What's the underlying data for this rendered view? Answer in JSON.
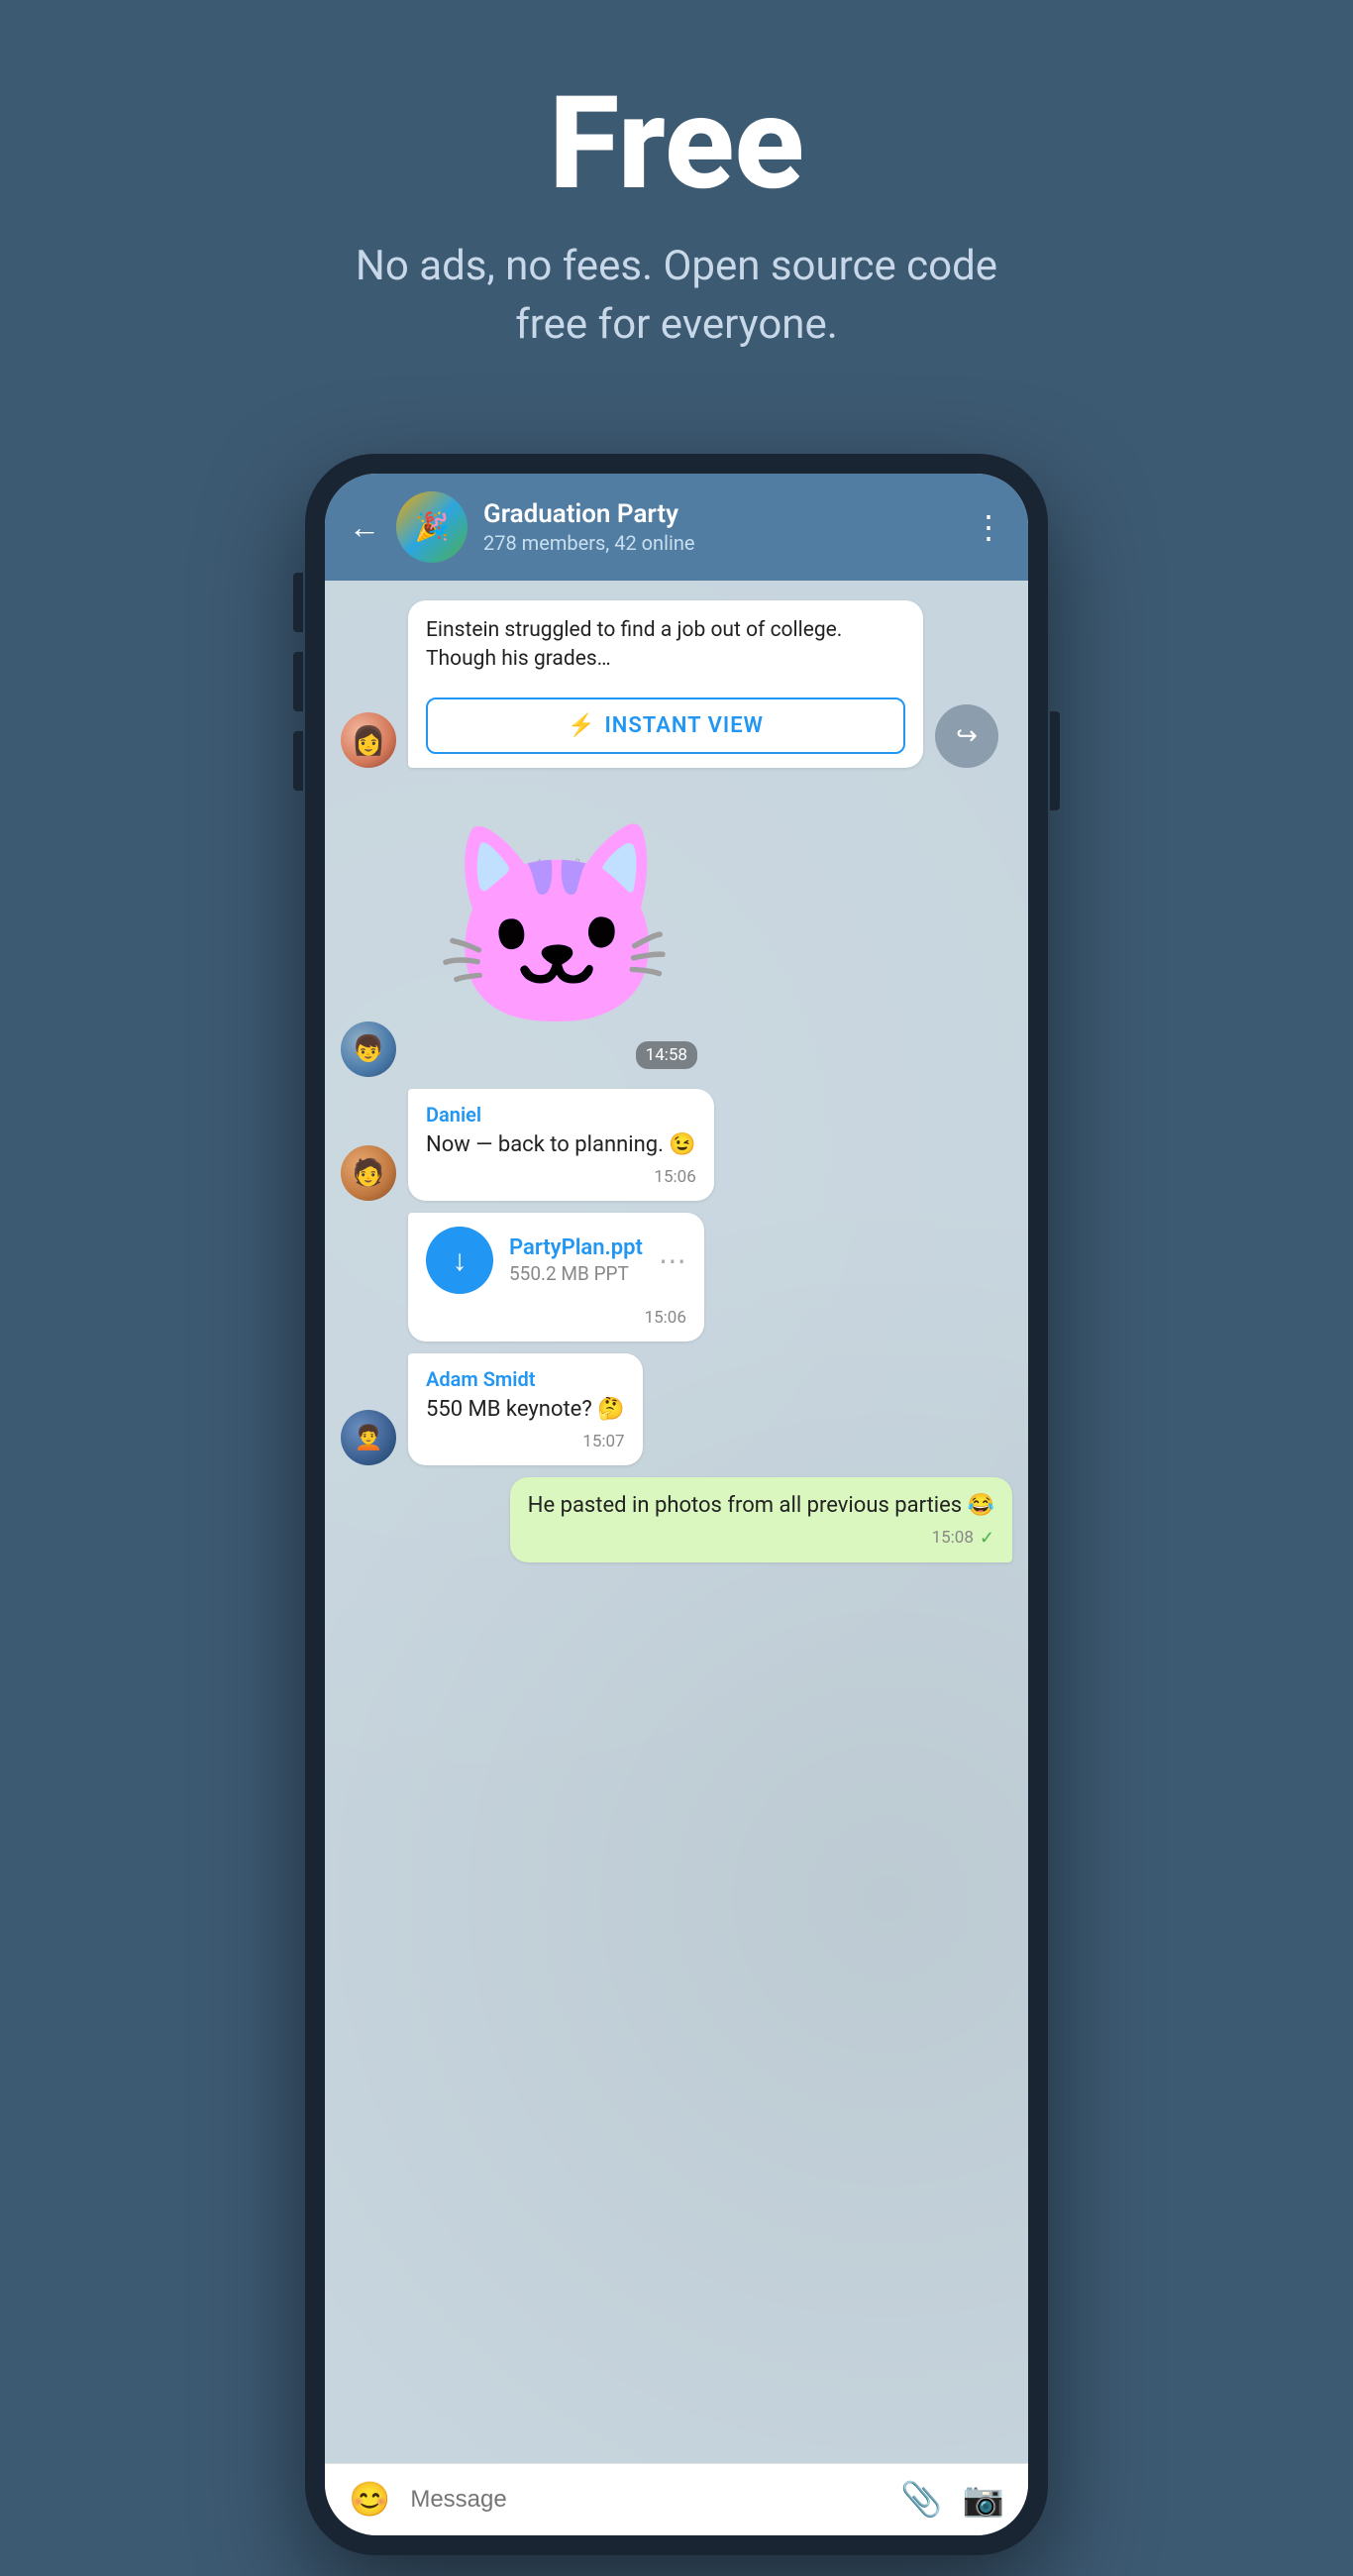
{
  "hero": {
    "title": "Free",
    "subtitle": "No ads, no fees. Open source code free for everyone."
  },
  "phone": {
    "header": {
      "group_name": "Graduation Party",
      "group_members": "278 members, 42 online",
      "back_label": "←",
      "menu_label": "⋮"
    },
    "messages": [
      {
        "id": "msg1",
        "type": "instant_view",
        "avatar": "female",
        "article_text": "Einstein struggled to find a job out of college. Though his grades…",
        "iv_button_label": "INSTANT VIEW",
        "iv_icon": "⚡"
      },
      {
        "id": "msg2",
        "type": "sticker",
        "avatar": "male1",
        "time": "14:58"
      },
      {
        "id": "msg3",
        "type": "text",
        "avatar": "male2",
        "sender": "Daniel",
        "text": "Now — back to planning. 😉",
        "time": "15:06"
      },
      {
        "id": "msg4",
        "type": "file",
        "avatar": "male2",
        "file_name": "PartyPlan.ppt",
        "file_size": "550.2 MB PPT",
        "time": "15:06"
      },
      {
        "id": "msg5",
        "type": "text",
        "avatar": "male3",
        "sender": "Adam Smidt",
        "text": "550 MB keynote? 🤔",
        "time": "15:07"
      },
      {
        "id": "msg6",
        "type": "self",
        "text": "He pasted in photos from all previous parties 😂",
        "time": "15:08",
        "has_tick": true
      }
    ],
    "input_bar": {
      "placeholder": "Message",
      "emoji_icon": "😊",
      "attach_icon": "📎",
      "camera_icon": "📷"
    }
  }
}
